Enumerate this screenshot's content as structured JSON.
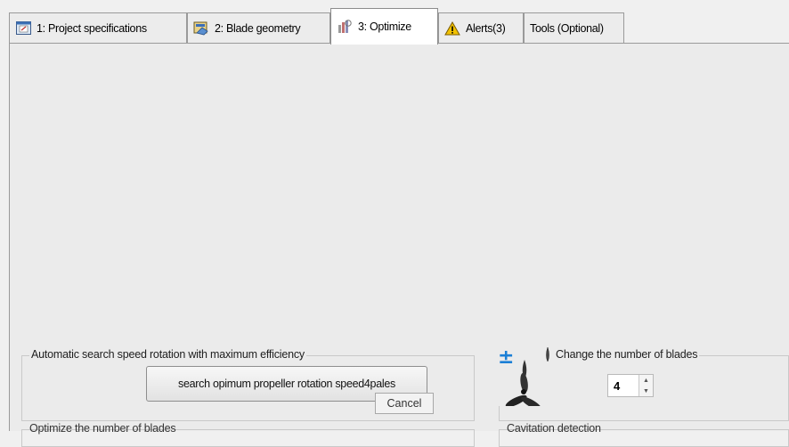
{
  "tabs": [
    {
      "label": "1: Project specifications",
      "icon": "project-icon"
    },
    {
      "label": "2: Blade geometry",
      "icon": "blade-geometry-icon"
    },
    {
      "label": "3: Optimize",
      "icon": "optimize-icon"
    },
    {
      "label": "Alerts(3)",
      "icon": "warning-icon"
    },
    {
      "label": "Tools (Optional)",
      "icon": ""
    }
  ],
  "active_tab_index": 2,
  "speed_group": {
    "legend": "Automatic search speed rotation with maximum efficiency",
    "search_button_label": "search opimum propeller rotation speed4pales",
    "cancel_button_label": "Cancel"
  },
  "blades_group": {
    "legend": "Change the number of blades",
    "icon": "propeller-blades-icon",
    "value": "4"
  },
  "optimize_blades_group": {
    "legend": "Optimize the number of blades"
  },
  "cavitation_group": {
    "legend": "Cavitation  detection"
  },
  "colors": {
    "panel_bg": "#ebebeb",
    "active_tab_bg": "#ffffff",
    "warning_yellow": "#f2c200",
    "plus_minus_blue": "#1b7fd6"
  }
}
